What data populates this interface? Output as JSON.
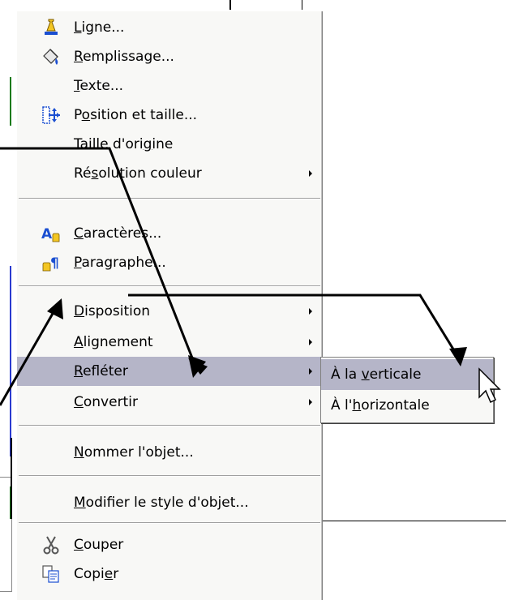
{
  "menu": {
    "items": [
      {
        "pre": "",
        "key": "L",
        "post": "igne...",
        "icon": "line-pen-icon"
      },
      {
        "pre": "",
        "key": "R",
        "post": "emplissage...",
        "icon": "paint-bucket-icon"
      },
      {
        "pre": "",
        "key": "T",
        "post": "exte...",
        "icon": ""
      },
      {
        "pre": "P",
        "key": "o",
        "post": "sition et taille...",
        "icon": "position-size-icon"
      },
      {
        "pre": "Taille d'ori",
        "key": "g",
        "post": "ine",
        "icon": ""
      },
      {
        "pre": "Ré",
        "key": "s",
        "post": "olution couleur",
        "icon": "",
        "submenu": true
      },
      {
        "pre": "",
        "key": "C",
        "post": "aractères...",
        "icon": "character-icon"
      },
      {
        "pre": "",
        "key": "P",
        "post": "aragraphe...",
        "icon": "paragraph-icon"
      },
      {
        "pre": "",
        "key": "D",
        "post": "isposition",
        "icon": "",
        "submenu": true
      },
      {
        "pre": "",
        "key": "A",
        "post": "lignement",
        "icon": "",
        "submenu": true
      },
      {
        "pre": "",
        "key": "R",
        "post": "efléter",
        "icon": "",
        "submenu": true,
        "highlighted": true
      },
      {
        "pre": "",
        "key": "C",
        "post": "onvertir",
        "icon": "",
        "submenu": true
      },
      {
        "pre": "",
        "key": "N",
        "post": "ommer l'objet...",
        "icon": ""
      },
      {
        "pre": "",
        "key": "M",
        "post": "odifier le style d'objet...",
        "icon": ""
      },
      {
        "pre": "",
        "key": "C",
        "post": "ouper",
        "icon": "scissors-icon"
      },
      {
        "pre": "Copi",
        "key": "e",
        "post": "r",
        "icon": "copy-icon"
      }
    ]
  },
  "submenu": {
    "items": [
      {
        "pre": "À la ",
        "key": "v",
        "post": "erticale",
        "highlighted": true
      },
      {
        "pre": "À l'",
        "key": "h",
        "post": "orizontale"
      }
    ]
  },
  "colors": {
    "menu_bg": "#f8f8f6",
    "highlight": "#b5b5c8",
    "arrow": "#000000"
  }
}
